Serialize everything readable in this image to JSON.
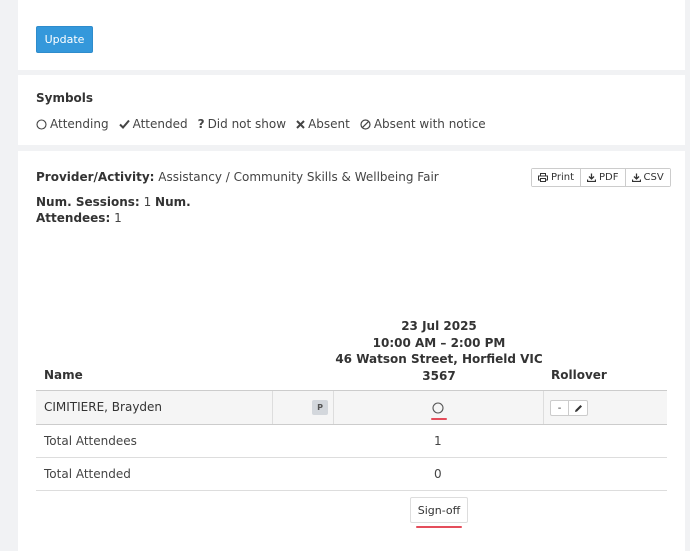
{
  "top": {
    "update_label": "Update"
  },
  "symbols": {
    "title": "Symbols",
    "items": [
      {
        "icon": "circle-outline-icon",
        "label": "Attending"
      },
      {
        "icon": "check-icon",
        "label": "Attended"
      },
      {
        "icon": "question-icon",
        "label": "Did not show"
      },
      {
        "icon": "cross-icon",
        "label": "Absent"
      },
      {
        "icon": "ban-icon",
        "label": "Absent with notice"
      }
    ]
  },
  "report": {
    "provider_label": "Provider/Activity:",
    "provider_value": "Assistancy / Community Skills & Wellbeing Fair",
    "sessions_label": "Num. Sessions:",
    "sessions_value": "1",
    "attendees_label_1": "Num.",
    "attendees_label_2": "Attendees:",
    "attendees_value": "1",
    "export": {
      "print": "Print",
      "pdf": "PDF",
      "csv": "CSV"
    }
  },
  "table": {
    "session": {
      "date": "23 Jul 2025",
      "time": "10:00 AM – 2:00 PM",
      "address_1": "46 Watson Street, Horfield VIC",
      "address_2": "3567"
    },
    "name_header": "Name",
    "rollover_header": "Rollover",
    "attendee": {
      "name": "CIMITIERE, Brayden",
      "badge": "P",
      "rollover_minus": "-"
    },
    "totals": [
      {
        "label": "Total Attendees",
        "value": "1"
      },
      {
        "label": "Total Attended",
        "value": "0"
      }
    ],
    "signoff_label": "Sign-off"
  },
  "colors": {
    "primary": "#3498db",
    "accent_underline": "#e44d5b",
    "badge_bg": "#d3d7dc"
  }
}
